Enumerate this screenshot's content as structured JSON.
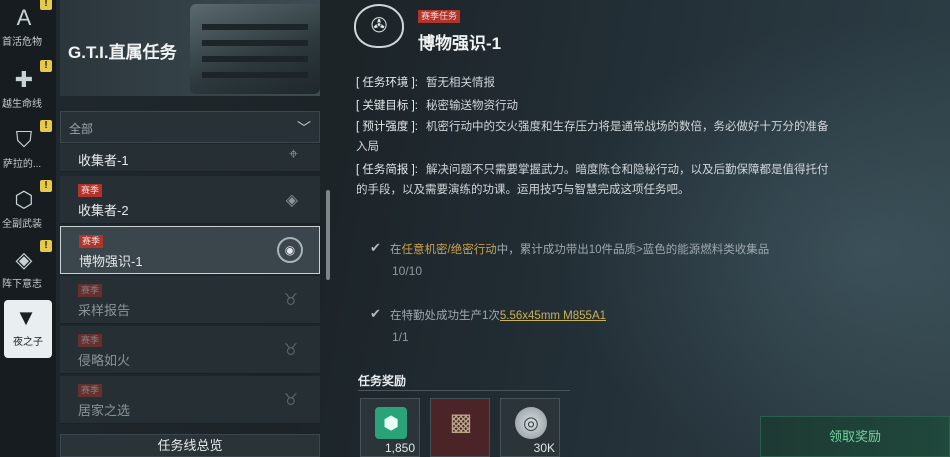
{
  "sidebar": {
    "items": [
      {
        "label": "首活危物",
        "icon": "triangle-logo-icon",
        "badge": "!"
      },
      {
        "label": "越生命线",
        "icon": "plus-cross-icon",
        "badge": "!"
      },
      {
        "label": "萨拉的...",
        "icon": "shield-icon",
        "badge": "!"
      },
      {
        "label": "全副武装",
        "icon": "hex-gear-icon",
        "badge": "!"
      },
      {
        "label": "阵下意志",
        "icon": "diamond-target-icon",
        "badge": "!"
      },
      {
        "label": "夜之子",
        "icon": "v-logo-icon",
        "active": true
      }
    ]
  },
  "banner": {
    "title": "G.T.I.直属任务"
  },
  "filter": {
    "label": "全部"
  },
  "missions": [
    {
      "tag": "",
      "title": "收集者-1",
      "state": "partial"
    },
    {
      "tag": "赛季",
      "title": "收集者-2",
      "state": "normal"
    },
    {
      "tag": "赛季",
      "title": "博物强识-1",
      "state": "selected"
    },
    {
      "tag": "赛季",
      "title": "采样报告",
      "state": "dim"
    },
    {
      "tag": "赛季",
      "title": "侵略如火",
      "state": "dim"
    },
    {
      "tag": "赛季",
      "title": "居家之选",
      "state": "dim"
    }
  ],
  "overview_button": "任务线总览",
  "detail": {
    "tag": "赛季任务",
    "title": "博物强识-1",
    "env_key": "[ 任务环境 ]:",
    "env_val": "暂无相关情报",
    "target_key": "[ 关键目标 ]:",
    "target_val": "秘密输送物资行动",
    "intensity_key": "[ 预计强度 ]:",
    "intensity_val": "机密行动中的交火强度和生存压力将是通常战场的数倍，务必做好十万分的准备",
    "intensity_val2": "入局",
    "brief_key": "[ 任务简报 ]:",
    "brief_val": "解决问题不只需要掌握武力。暗度陈仓和隐秘行动，以及后勤保障都是值得托付",
    "brief_val2": "的手段，以及需要演练的功课。运用技巧与智慧完成这项任务吧。"
  },
  "objectives": [
    {
      "prefix": "在",
      "hl": "任意机密/绝密行动",
      "suffix": "中，累计成功带出10件品质>蓝色的能源燃料类收集品",
      "progress": "10/10"
    },
    {
      "prefix": "在特勤处成功生产1次",
      "link": "5.56x45mm M855A1",
      "progress": "1/1"
    }
  ],
  "rewards": {
    "title": "任务奖励",
    "items": [
      {
        "icon": "exp-badge-icon",
        "value": "1,850",
        "color": "#2aa37a"
      },
      {
        "icon": "body-armor-icon",
        "value": "",
        "color": "#8a2f2f"
      },
      {
        "icon": "coin-icon",
        "value": "30K",
        "color": "#b8c0c4"
      }
    ]
  },
  "claim_button": "领取奖励"
}
